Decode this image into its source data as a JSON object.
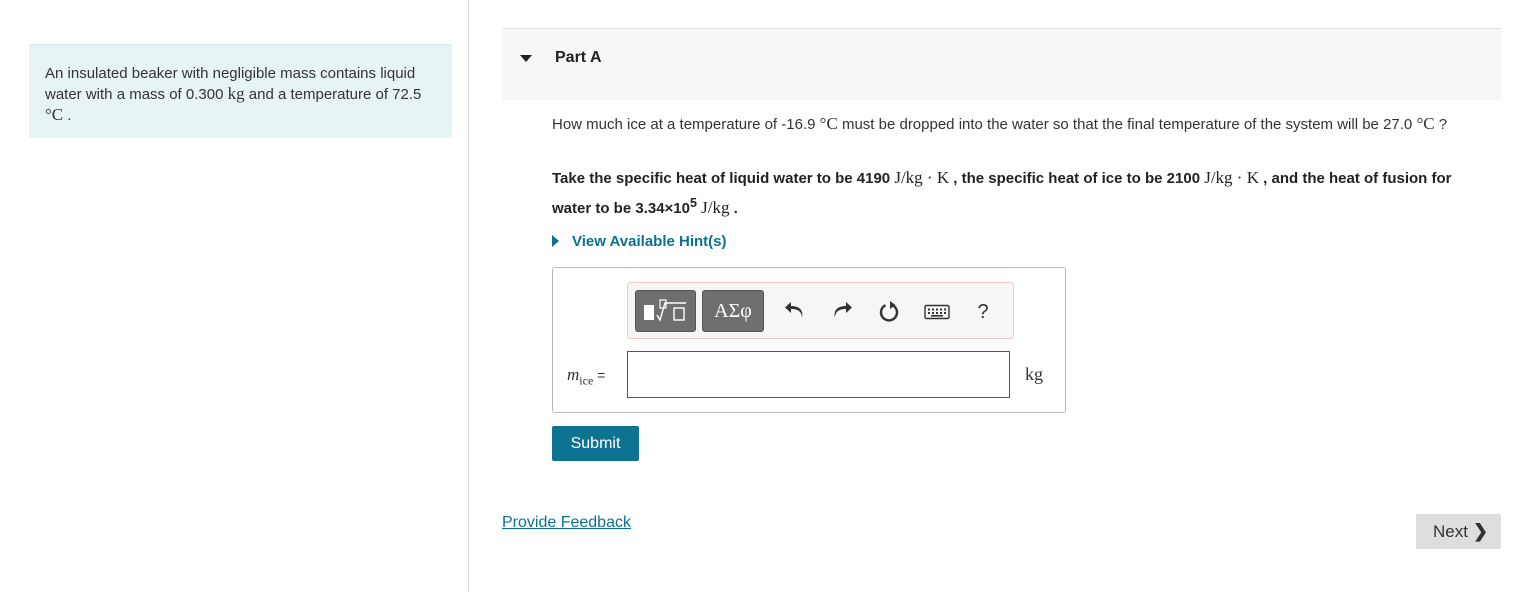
{
  "problem": {
    "text_1": "An insulated beaker with negligible mass contains liquid water with a mass of 0.300 ",
    "mass_unit": "kg",
    "text_2": " and a temperature of 72.5 ",
    "temp_unit": "°C",
    "text_3": " ."
  },
  "part": {
    "title": "Part A"
  },
  "question": {
    "text_1": "How much ice at a temperature of -16.9 ",
    "unit_1": "°C",
    "text_2": " must be dropped into the water so that the final temperature of the system will be 27.0 ",
    "unit_2": "°C",
    "text_3": " ?"
  },
  "constants": {
    "text_1": "Take the specific heat of liquid water to be 4190 ",
    "unit_1": "J/kg · K",
    "text_2": " , the specific heat of ice to be 2100 ",
    "unit_2": "J/kg · K",
    "text_3": " , and the heat of fusion for water to be 3.34×10",
    "exp": "5",
    "unit_3": "J/kg",
    "text_4": " ."
  },
  "hint": {
    "label": "View Available Hint(s)"
  },
  "answer": {
    "var_main": "m",
    "var_sub": "ice",
    "equals": " =",
    "input_value": "",
    "unit": "kg"
  },
  "toolbar": {
    "templates_icon": "templates-icon",
    "symbols_label": "ΑΣφ",
    "undo_icon": "undo-icon",
    "redo_icon": "redo-icon",
    "reset_icon": "reset-icon",
    "keyboard_icon": "keyboard-icon",
    "help_label": "?"
  },
  "buttons": {
    "submit": "Submit",
    "feedback": "Provide Feedback",
    "next": "Next"
  },
  "colors": {
    "accent": "#0e7390",
    "problem_bg": "#e6f4f6"
  }
}
